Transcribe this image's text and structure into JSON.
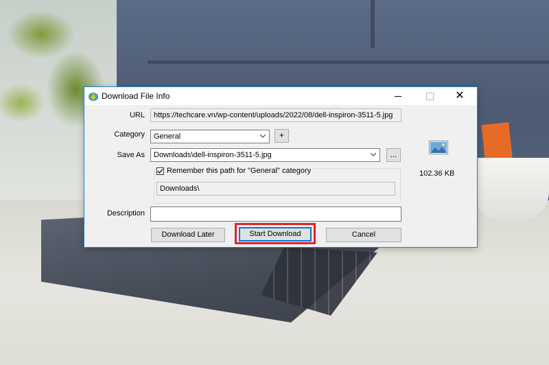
{
  "window": {
    "title": "Download File Info",
    "minimize": "minimize",
    "maximize": "maximize",
    "close": "✕"
  },
  "form": {
    "url_label": "URL",
    "url_value": "https://techcare.vn/wp-content/uploads/2022/08/dell-inspiron-3511-5.jpg",
    "category_label": "Category",
    "category_value": "General",
    "add_category_label": "+",
    "save_as_label": "Save As",
    "save_as_value": "Downloads\\dell-inspiron-3511-5.jpg",
    "browse_label": "...",
    "remember_checked": true,
    "remember_label": "Remember this path for \"General\" category",
    "remember_path": "Downloads\\",
    "description_label": "Description",
    "description_value": ""
  },
  "file_info": {
    "size": "102.36  KB",
    "icon": "image-file-icon"
  },
  "buttons": {
    "download_later": "Download Later",
    "start_download": "Start Download",
    "cancel": "Cancel"
  },
  "colors": {
    "highlight": "#e0222c",
    "window_border": "#1883d7",
    "default_button_border": "#0078d7"
  }
}
